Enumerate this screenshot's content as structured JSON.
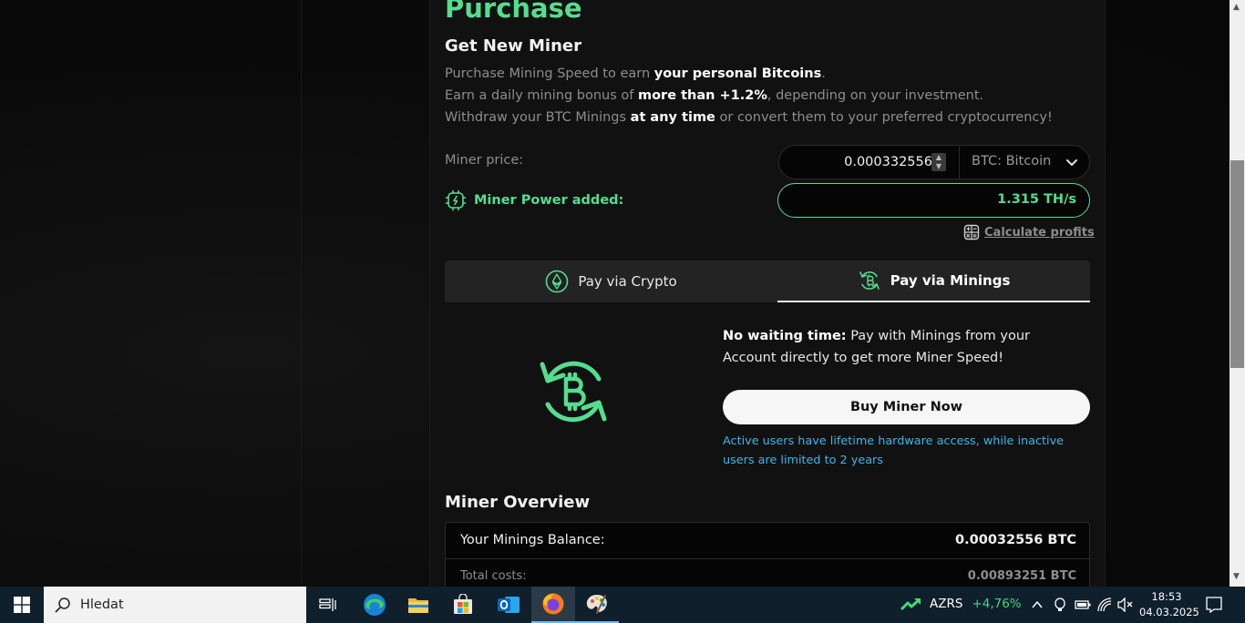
{
  "purchase": {
    "title": "Purchase",
    "subtitle": "Get New Miner",
    "desc1_a": "Purchase Mining Speed to earn ",
    "desc1_b": "your personal Bitcoins",
    "desc1_c": ".",
    "desc2_a": "Earn a daily mining bonus of ",
    "desc2_b": "more than +1.2%",
    "desc2_c": ", depending on your investment.",
    "desc3_a": "Withdraw your BTC Minings ",
    "desc3_b": "at any time",
    "desc3_c": " or convert them to your preferred cryptocurrency!",
    "price_label": "Miner price:",
    "price_value": "0.000332556",
    "currency": "BTC: Bitcoin",
    "power_label": "Miner Power added:",
    "power_value": "1.315 TH/s",
    "calc_label": "Calculate profits"
  },
  "tabs": {
    "crypto": "Pay via Crypto",
    "minings": "Pay via Minings"
  },
  "minings": {
    "lead": "No waiting time:",
    "body": " Pay with Minings from your Account directly to get more Miner Speed!",
    "buy_button": "Buy Miner Now",
    "note": "Active users have lifetime hardware access, while inactive users are limited to 2 years"
  },
  "overview": {
    "title": "Miner Overview",
    "balance_label": "Your Minings Balance:",
    "balance_value": "0.00032556 BTC",
    "costs_label": "Total costs:",
    "costs_value": "0.00893251 BTC"
  },
  "taskbar": {
    "search_placeholder": "Hledat",
    "stock_name": "AZRS",
    "stock_change": "+4,76%",
    "time": "18:53",
    "date": "04.03.2025"
  },
  "colors": {
    "accent_green": "#54dd8f",
    "note_blue": "#37b8ec",
    "taskbar": "#0f1f2b"
  }
}
